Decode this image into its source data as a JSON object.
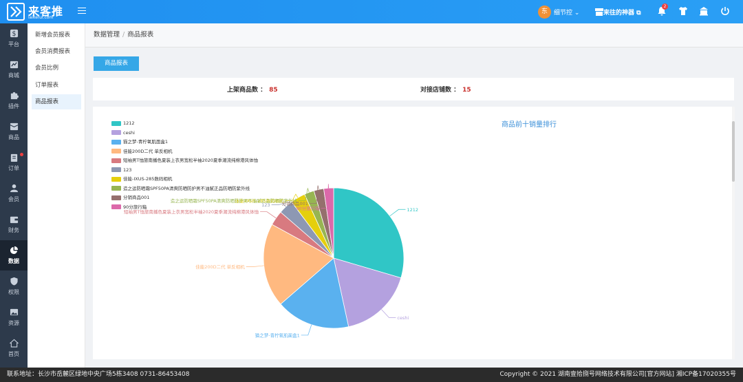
{
  "app": {
    "logo_text": "来客推",
    "logo_sub": "laikefui.com"
  },
  "topbar": {
    "user_avatar": "东",
    "user_name": "细节控 ",
    "shop_name": "来往的神器 ",
    "notif_count": "2"
  },
  "sidebar": {
    "items": [
      {
        "label": "平台",
        "icon": "dollar-icon"
      },
      {
        "label": "商城",
        "icon": "shop-icon"
      },
      {
        "label": "插件",
        "icon": "puzzle-icon"
      },
      {
        "label": "商品",
        "icon": "box-icon"
      },
      {
        "label": "订单",
        "icon": "clipboard-icon"
      },
      {
        "label": "会员",
        "icon": "user-icon"
      },
      {
        "label": "财务",
        "icon": "wallet-icon"
      },
      {
        "label": "数据",
        "icon": "pie-chart-icon"
      },
      {
        "label": "权限",
        "icon": "shield-icon"
      },
      {
        "label": "资源",
        "icon": "image-icon"
      },
      {
        "label": "首页",
        "icon": "home-icon"
      }
    ],
    "active": "数据"
  },
  "subnav": {
    "items": [
      "新增会员报表",
      "会员消费报表",
      "会员比例",
      "订单报表",
      "商品报表"
    ],
    "active": "商品报表"
  },
  "breadcrumb": {
    "parent": "数据管理",
    "separator": "/",
    "current": "商品报表"
  },
  "tab": {
    "label": "商品报表"
  },
  "stats": {
    "listed_label": "上架商品数 ：",
    "listed_value": "85",
    "stores_label": "对接店铺数 ：",
    "stores_value": "15"
  },
  "chart_data": {
    "type": "pie",
    "title": "商品前十销量排行",
    "legend_position": "top-left",
    "slices": [
      {
        "name": "1212",
        "value": 26,
        "color": "#30c6c6"
      },
      {
        "name": "ceshi",
        "value": 15,
        "color": "#b4a1df"
      },
      {
        "name": "猫之梦-青柠氧肌面盒1",
        "value": 15,
        "color": "#5ab1ef"
      },
      {
        "name": "佳能200D二代 单反相机",
        "value": 17,
        "color": "#ffb980"
      },
      {
        "name": "短袖男T恤旅南播色夏装上衣男宽松半袖2020夏季潮流纯棉港风体恤",
        "value": 3,
        "color": "#d87a80"
      },
      {
        "name": "123",
        "value": 3,
        "color": "#8d98b3"
      },
      {
        "name": "佳能-IXUS-285数码相机",
        "value": 3,
        "color": "#e5cf0d"
      },
      {
        "name": "造之运防晒霜SPF50PA清爽防晒防护男不油腻正品防晒防紫外线",
        "value": 2,
        "color": "#97b552"
      },
      {
        "name": "分销商品001",
        "value": 2,
        "color": "#95706d"
      },
      {
        "name": "90分旅行箱",
        "value": 2,
        "color": "#dc69aa"
      }
    ]
  },
  "footer": {
    "left": "联系地址：长沙市岳麓区绿地中央广场5栋3408 0731-86453408",
    "right": "Copyright © 2021 湖南壹拾捌号网络技术有限公司[官方网站]  湘ICP备17020355号"
  }
}
